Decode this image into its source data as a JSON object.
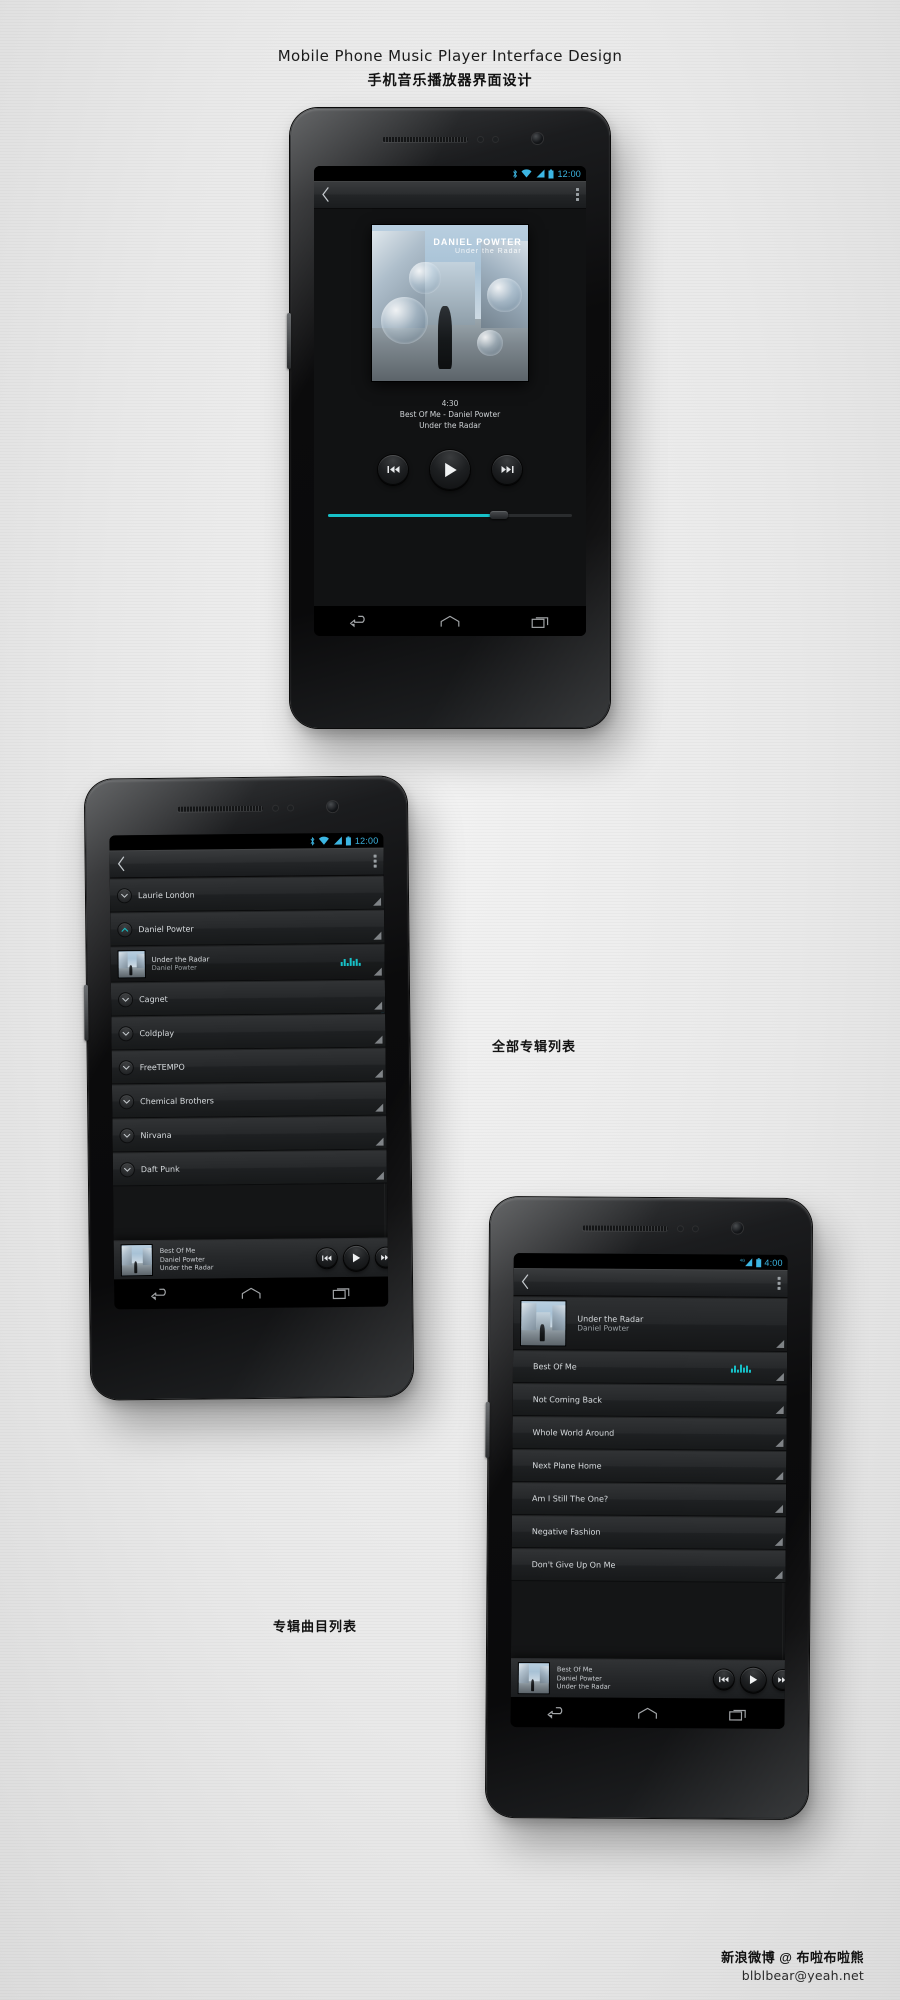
{
  "header": {
    "title_en": "Mobile Phone Music Player Interface Design",
    "title_cn": "手机音乐播放器界面设计"
  },
  "annotations": {
    "albums_label": "全部专辑列表",
    "tracks_label": "专辑曲目列表"
  },
  "credit": {
    "weibo": "新浪微博 @ 布啦布啦熊",
    "email": "blblbear@yeah.net"
  },
  "album": {
    "artist": "DANIEL POWTER",
    "title": "Under the Radar"
  },
  "phone1": {
    "statusbar": {
      "time": "12:00",
      "icons": [
        "bluetooth-icon",
        "wifi-icon",
        "signal-icon",
        "battery-icon"
      ]
    },
    "actionbar": {
      "back": "back-chevron-icon",
      "overflow": "overflow-menu-icon"
    },
    "now_playing": {
      "duration": "4:30",
      "track_line": "Best Of Me - Daniel Powter",
      "album_line": "Under the Radar",
      "progress_percent": 70
    },
    "controls": {
      "previous": "skip-previous-icon",
      "play": "play-icon",
      "next": "skip-next-icon"
    },
    "navbar": [
      "back-nav-icon",
      "home-nav-icon",
      "recents-nav-icon"
    ]
  },
  "phone2": {
    "statusbar": {
      "time": "12:00",
      "icons": [
        "bluetooth-icon",
        "wifi-icon",
        "signal-icon",
        "battery-icon"
      ]
    },
    "rows": [
      {
        "label": "Laurie London",
        "expanded": false,
        "type": "artist"
      },
      {
        "label": "Daniel Powter",
        "expanded": true,
        "type": "artist"
      },
      {
        "label": "Under the Radar",
        "sub": "Daniel Powter",
        "type": "album",
        "playing": true
      },
      {
        "label": "Cagnet",
        "expanded": false,
        "type": "artist"
      },
      {
        "label": "Coldplay",
        "expanded": false,
        "type": "artist"
      },
      {
        "label": "FreeTEMPO",
        "expanded": false,
        "type": "artist"
      },
      {
        "label": "Chemical Brothers",
        "expanded": false,
        "type": "artist"
      },
      {
        "label": "Nirvana",
        "expanded": false,
        "type": "artist"
      },
      {
        "label": "Daft Punk",
        "expanded": false,
        "type": "artist"
      }
    ],
    "miniplayer": {
      "track": "Best Of Me",
      "artist": "Daniel Powter",
      "album": "Under the Radar",
      "previous": "skip-previous-icon",
      "play": "play-icon",
      "next": "skip-next-icon"
    },
    "navbar": [
      "back-nav-icon",
      "home-nav-icon",
      "recents-nav-icon"
    ]
  },
  "phone3": {
    "statusbar": {
      "time": "4:00",
      "icons": [
        "4g-icon",
        "signal-icon",
        "battery-icon"
      ],
      "network": "4G"
    },
    "album_header": {
      "title": "Under the Radar",
      "artist": "Daniel Powter"
    },
    "tracks": [
      {
        "label": "Best Of Me",
        "playing": true
      },
      {
        "label": "Not Coming Back",
        "playing": false
      },
      {
        "label": "Whole World Around",
        "playing": false
      },
      {
        "label": "Next Plane Home",
        "playing": false
      },
      {
        "label": "Am I Still The One?",
        "playing": false
      },
      {
        "label": "Negative Fashion",
        "playing": false
      },
      {
        "label": "Don't Give Up On Me",
        "playing": false
      }
    ],
    "miniplayer": {
      "track": "Best Of Me",
      "artist": "Daniel Powter",
      "album": "Under the Radar",
      "previous": "skip-previous-icon",
      "play": "play-icon",
      "next": "skip-next-icon"
    },
    "navbar": [
      "back-nav-icon",
      "home-nav-icon",
      "recents-nav-icon"
    ]
  },
  "colors": {
    "accent_cyan": "#17c1c8",
    "status_blue": "#3cb6e3",
    "scrollbar_blue": "#2eaee6",
    "screen_bg": "#141516",
    "page_bg": "#ececec"
  }
}
